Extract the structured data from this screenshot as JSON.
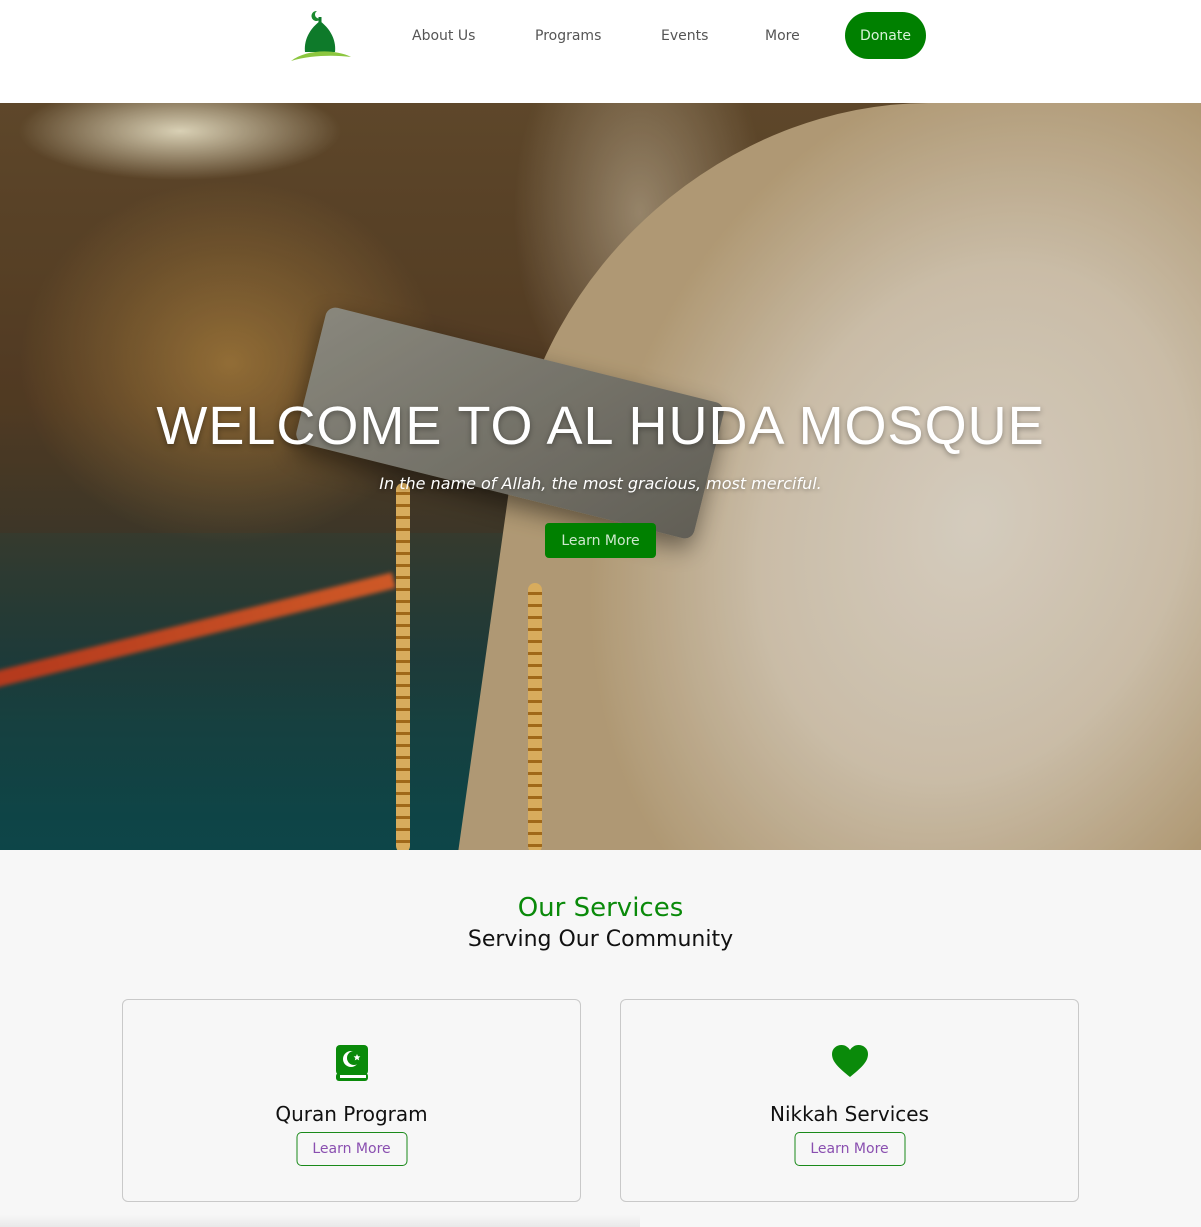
{
  "header": {
    "nav": [
      "About Us",
      "Programs",
      "Events",
      "More"
    ],
    "donate_label": "Donate"
  },
  "hero": {
    "title": "WELCOME TO AL HUDA MOSQUE",
    "subtitle": "In the name of Allah, the most gracious, most merciful.",
    "button_label": "Learn More"
  },
  "services": {
    "title": "Our Services",
    "subtitle": "Serving Our Community",
    "cards": [
      {
        "icon": "quran-icon",
        "title": "Quran Program",
        "button_label": "Learn More"
      },
      {
        "icon": "heart-icon",
        "title": "Nikkah Services",
        "button_label": "Learn More"
      }
    ]
  },
  "colors": {
    "brand_green": "#008000",
    "heading_green": "#0a8a0a",
    "link_purple": "#8a4fb0"
  }
}
